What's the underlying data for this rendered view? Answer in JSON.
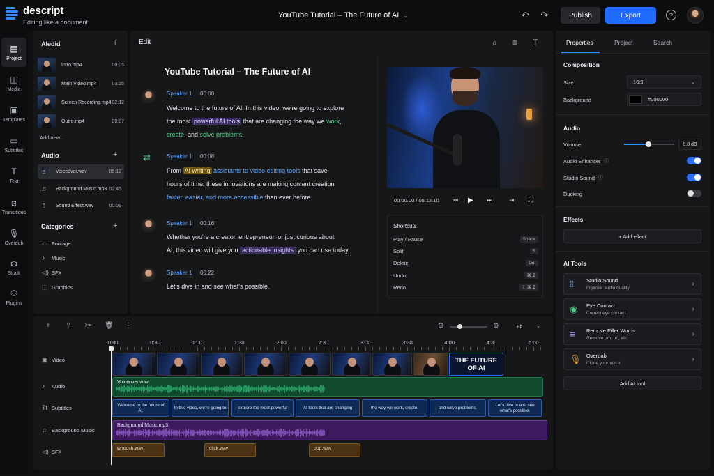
{
  "app": {
    "name": "descript",
    "tagline": "Editing like a document."
  },
  "header": {
    "doc_title": "YouTube Tutorial – The Future of AI",
    "publish": "Publish",
    "export": "Export",
    "help": "?"
  },
  "nav": [
    "Project",
    "Media",
    "Templates",
    "Subtitles",
    "Text",
    "Transitions",
    "Overdub",
    "Stock",
    "Plugins"
  ],
  "media_panel": {
    "title": "Aledid",
    "videos": [
      {
        "name": "Intro.mp4",
        "dur": "00:05"
      },
      {
        "name": "Main Video.mp4",
        "dur": "03:25"
      },
      {
        "name": "Screen Recording.mp4",
        "dur": "02:12"
      },
      {
        "name": "Outro.mp4",
        "dur": "00:07"
      }
    ],
    "add_new": "Add new...",
    "audio_title": "Audio",
    "audio": [
      {
        "name": "Voiceover.wav",
        "dur": "05:12"
      },
      {
        "name": "Background Music.mp3",
        "dur": "02:45"
      },
      {
        "name": "Sound Effect.wav",
        "dur": "00:09"
      }
    ],
    "categories_title": "Categories",
    "categories": [
      "Footage",
      "Music",
      "SFX",
      "Graphics"
    ]
  },
  "editor": {
    "header": "Edit",
    "title": "YouTube Tutorial – The Future of AI",
    "blocks": [
      {
        "speaker": "Speaker 1",
        "time": "00:00"
      },
      {
        "speaker": "Speaker 1",
        "time": "00:08"
      },
      {
        "speaker": "Speaker 1",
        "time": "00:16"
      },
      {
        "speaker": "Speaker 1",
        "time": "00:22"
      }
    ],
    "p1": [
      "Welcome to the future of AI. In this video, we're going to explore",
      "the most ",
      "powerful AI tools",
      " that are changing the way we ",
      "work",
      ",",
      "create",
      ", and ",
      "solve problems",
      "."
    ],
    "p2": [
      "From ",
      "AI writing",
      " ",
      "assistants to video editing tools",
      " that save",
      "hours of time, these innovations are making content creation",
      "faster, easier, and more accessible",
      " than ever before."
    ],
    "p3": [
      "Whether you're a creator, entrepreneur, or just curious about",
      "AI, this video will give you ",
      "actionable insights",
      " you can use today."
    ],
    "p4": [
      "Let's dive in and see what's possible."
    ]
  },
  "preview": {
    "time": "00:00.00 / 05:12.10"
  },
  "shortcuts": {
    "title": "Shortcuts",
    "items": [
      {
        "label": "Play / Pause",
        "key": "Space"
      },
      {
        "label": "Split",
        "key": "S"
      },
      {
        "label": "Delete",
        "key": "Del"
      },
      {
        "label": "Undo",
        "key": "⌘ Z"
      },
      {
        "label": "Redo",
        "key": "⇧ ⌘ Z"
      }
    ]
  },
  "properties": {
    "tabs": [
      "Properties",
      "Project",
      "Search"
    ],
    "composition": "Composition",
    "size_label": "Size",
    "size_value": "16:9",
    "bg_label": "Background",
    "bg_value": "#000000",
    "audio": "Audio",
    "volume_label": "Volume",
    "volume_value": "0.0 dB",
    "volume_level": 0.47,
    "enhancer": "Audio Enhancer",
    "studio_sound": "Studio Sound",
    "ducking": "Ducking",
    "effects": "Effects",
    "add_effect": "+ Add effect",
    "ai_tools": "AI Tools",
    "tools": [
      {
        "name": "Studio Sound",
        "desc": "Improve audio quality",
        "color": "#6aa8ff"
      },
      {
        "name": "Eye Contact",
        "desc": "Correct eye contact",
        "color": "#4fd18b"
      },
      {
        "name": "Remove Filler Words",
        "desc": "Remove um, uh, etc.",
        "color": "#b58cff"
      },
      {
        "name": "Overdub",
        "desc": "Clone your voice",
        "color": "#f0a53a"
      }
    ],
    "add_ai": "Add AI tool"
  },
  "timeline": {
    "fit": "Fit",
    "ruler": [
      "0:00",
      "0:30",
      "1:00",
      "1:30",
      "2:00",
      "2:30",
      "3:00",
      "3:30",
      "4:00",
      "4:30",
      "5:00"
    ],
    "tracks": [
      "Video",
      "Audio",
      "Subtitles",
      "Background Music",
      "SFX"
    ],
    "title_card": [
      "THE FUTURE",
      "OF AI"
    ],
    "voiceover": "Voiceover.wav",
    "bgm": "Background Music.mp3",
    "subs": [
      "Welcome to the future of AI.",
      "In this video, we're going to",
      "explore the most powerful",
      "AI tools that are changing",
      "the way we work, create,",
      "and solve problems.",
      "Let's dive in and see what's possible."
    ],
    "sfx": [
      "whoosh.wav",
      "click.wav",
      "pop.wav"
    ]
  }
}
